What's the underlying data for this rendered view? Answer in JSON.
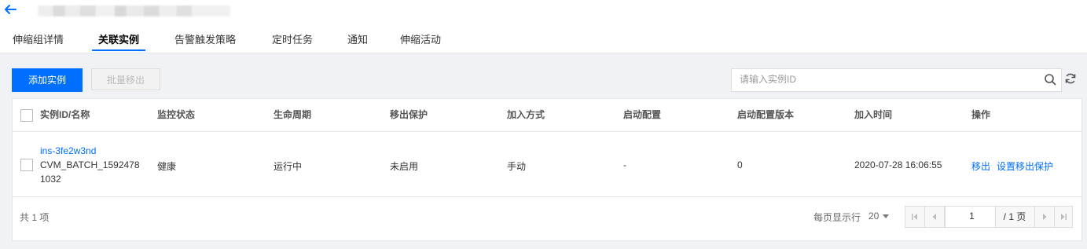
{
  "tabs": [
    "伸缩组详情",
    "关联实例",
    "告警触发策略",
    "定时任务",
    "通知",
    "伸缩活动"
  ],
  "active_tab": "关联实例",
  "toolbar": {
    "add_label": "添加实例",
    "batch_remove_label": "批量移出"
  },
  "search": {
    "placeholder": "请输入实例ID"
  },
  "table": {
    "headers": [
      "实例ID/名称",
      "监控状态",
      "生命周期",
      "移出保护",
      "加入方式",
      "启动配置",
      "启动配置版本",
      "加入时间",
      "操作"
    ],
    "rows": [
      {
        "instance_id": "ins-3fe2w3nd",
        "name_line1": "CVM_BATCH_1592478",
        "name_line2": "1032",
        "monitor": "健康",
        "lifecycle": "运行中",
        "protection": "未启用",
        "join_method": "手动",
        "launch_config": "-",
        "launch_version": "0",
        "join_time": "2020-07-28 16:06:55",
        "actions": [
          "移出",
          "设置移出保护"
        ]
      }
    ]
  },
  "footer": {
    "total": "共 1 项",
    "page_size_label": "每页显示行",
    "page_size": "20",
    "current_page": "1",
    "total_pages": "/ 1 页"
  },
  "colors": {
    "primary": "#006eff",
    "border": "#e3e5e8",
    "background": "#f0f2f5"
  }
}
